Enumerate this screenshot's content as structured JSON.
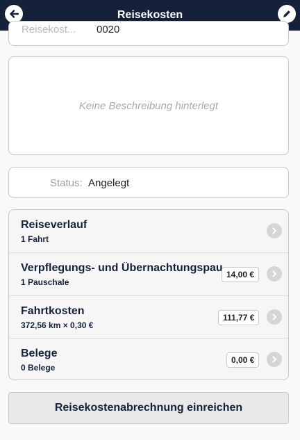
{
  "header": {
    "title": "Reisekosten",
    "back_icon": "arrow-left-icon",
    "edit_icon": "pencil-icon"
  },
  "top_card": {
    "label": "Reisekost...",
    "value": "0020"
  },
  "description": {
    "text": "Keine Beschreibung hinterlegt"
  },
  "status": {
    "label": "Status:",
    "value": "Angelegt"
  },
  "items": [
    {
      "title": "Reiseverlauf",
      "subtitle": "1 Fahrt",
      "amount": ""
    },
    {
      "title": "Verpflegungs- und Übernachtungspau",
      "subtitle": "1 Pauschale",
      "amount": "14,00 €"
    },
    {
      "title": "Fahrtkosten",
      "subtitle": "372,56 km × 0,30 €",
      "amount": "111,77 €"
    },
    {
      "title": "Belege",
      "subtitle": "0 Belege",
      "amount": "0,00 €"
    }
  ],
  "submit": {
    "label": "Reisekostenabrechnung einreichen"
  },
  "colors": {
    "header_bg": "#15213a",
    "accent_text": "#15213a"
  }
}
